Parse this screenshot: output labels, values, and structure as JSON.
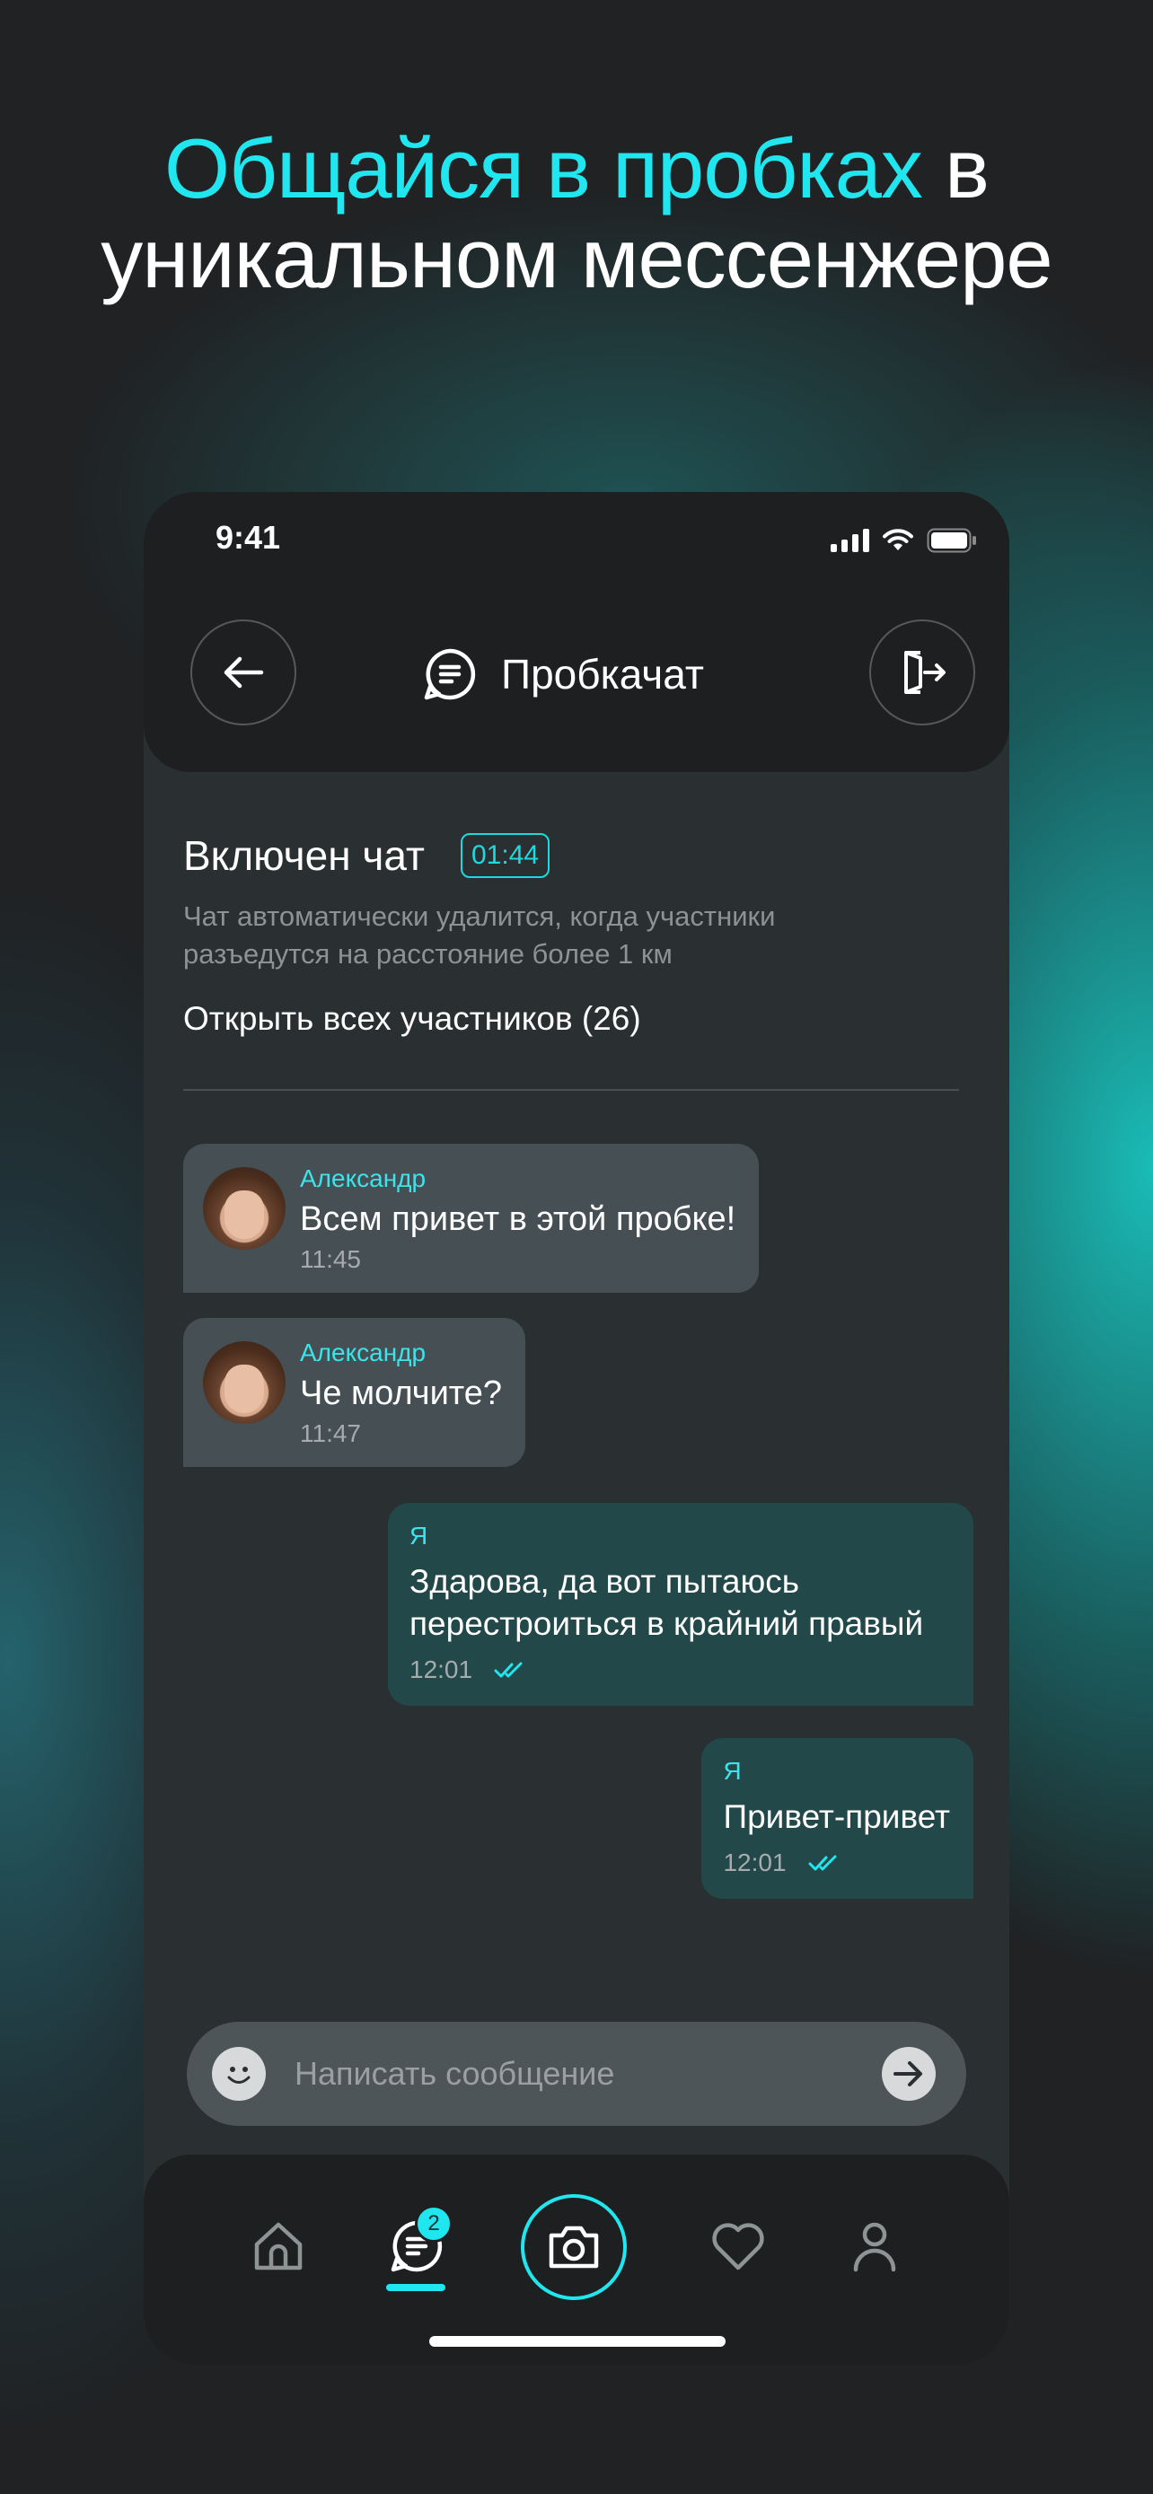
{
  "headline": {
    "accent": "Общайся в пробках",
    "rest_line1": " в",
    "line2": "уникальном мессенжере"
  },
  "status_bar": {
    "time": "9:41"
  },
  "header": {
    "back_icon": "arrow-left-icon",
    "chat_icon": "chat-bubble-icon",
    "title": "Пробкачат",
    "exit_icon": "exit-door-icon"
  },
  "chat_info": {
    "title": "Включен чат",
    "timer": "01:44",
    "description": "Чат автоматически удалится, когда участники разъедутся на расстояние более 1 км",
    "members_link": "Открыть всех участников (26)"
  },
  "messages": [
    {
      "sender": "Александр",
      "text": "Всем привет в этой пробке!",
      "time": "11:45"
    },
    {
      "sender": "Александр",
      "text": "Че молчите?",
      "time": "11:47"
    },
    {
      "sender": "Я",
      "text": "Здарова, да вот пытаюсь перестроиться в крайний правый",
      "time": "12:01"
    },
    {
      "sender": "Я",
      "text": "Привет-привет",
      "time": "12:01"
    }
  ],
  "composer": {
    "placeholder": "Написать сообщение"
  },
  "bottom_nav": {
    "chat_badge": "2"
  },
  "colors": {
    "accent": "#20e6ef",
    "background": "#202224",
    "incoming_bubble": "#454f54",
    "outgoing_bubble": "#22484a"
  }
}
